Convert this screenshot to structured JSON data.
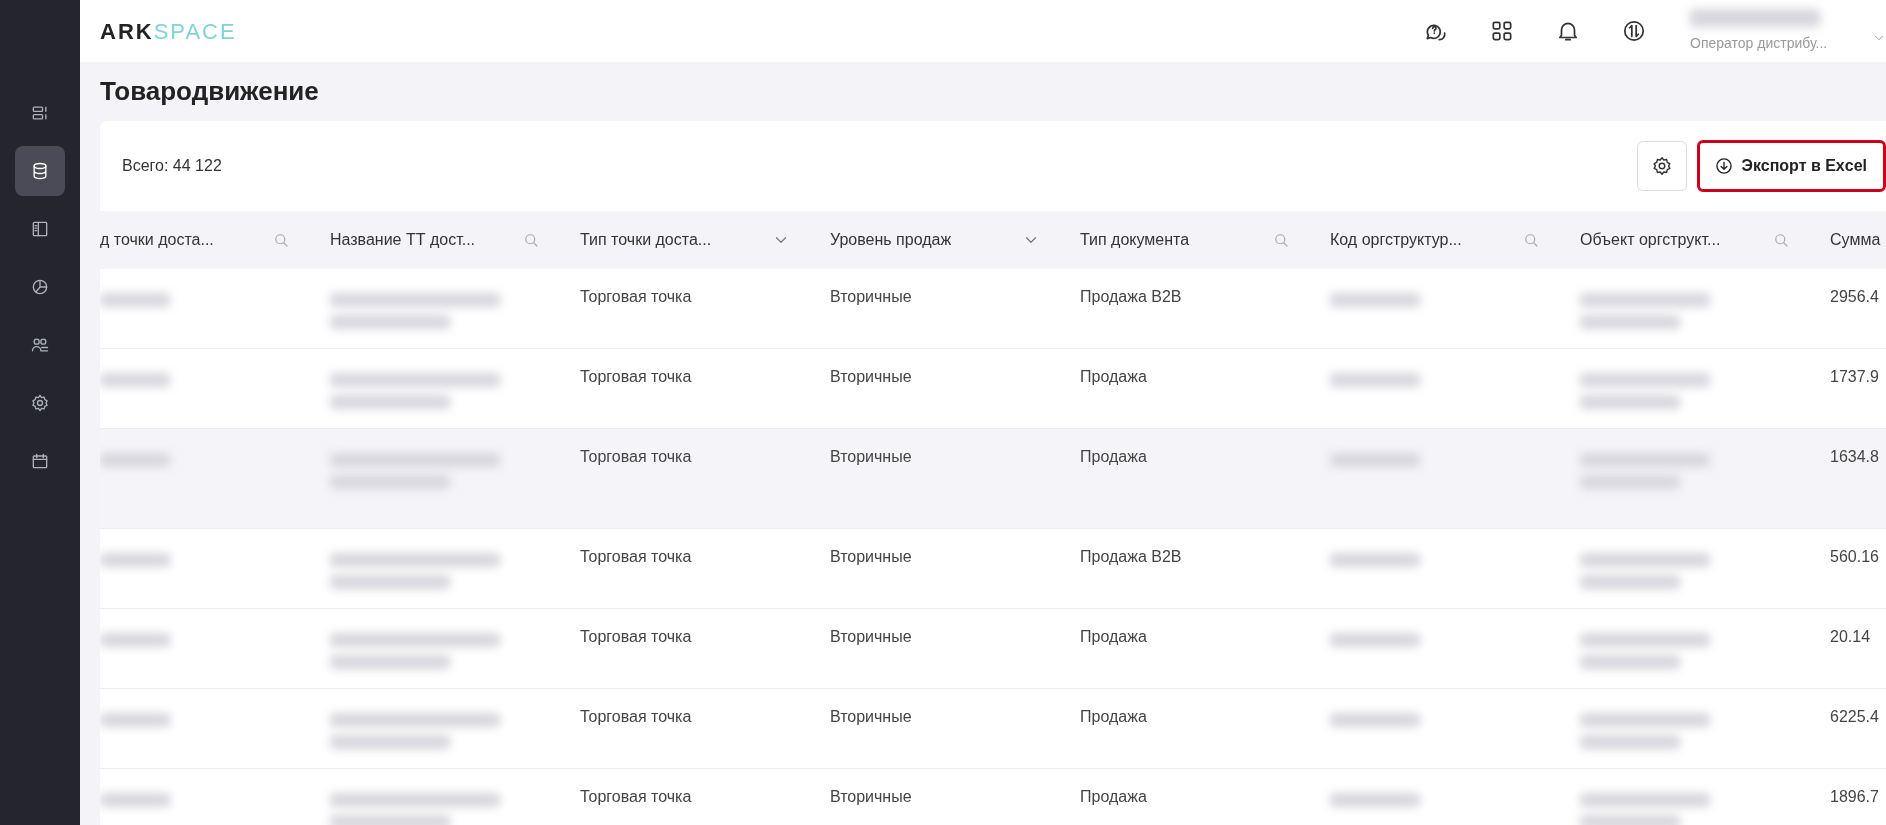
{
  "logo": {
    "part_1": "ARK",
    "part_2": "SPACE"
  },
  "user": {
    "role": "Оператор дистрибу..."
  },
  "sidebar": {
    "items": [
      {
        "selected": false
      },
      {
        "selected": true
      },
      {
        "selected": false
      },
      {
        "selected": false
      },
      {
        "selected": false
      },
      {
        "selected": false
      },
      {
        "selected": false
      }
    ]
  },
  "page_title": "Товародвижение",
  "total": "Всего: 44 122",
  "export_button": {
    "label": "Экспорт в Excel",
    "highlighted": true
  },
  "table": {
    "columns": [
      {
        "label": "д точки доста...",
        "kind": "search"
      },
      {
        "label": "Название ТТ дост...",
        "kind": "search"
      },
      {
        "label": "Тип точки доста...",
        "kind": "dropdown"
      },
      {
        "label": "Уровень продаж",
        "kind": "dropdown"
      },
      {
        "label": "Тип документа",
        "kind": "search"
      },
      {
        "label": "Код оргструктур...",
        "kind": "search"
      },
      {
        "label": "Объект оргструкт...",
        "kind": "search"
      },
      {
        "label": "Сумма",
        "kind": "plain"
      }
    ],
    "rows": [
      {
        "point_type": "Торговая точка",
        "sales_level": "Вторичные",
        "document_type": "Продажа B2B",
        "sum": "2956.4",
        "hovered": false
      },
      {
        "point_type": "Торговая точка",
        "sales_level": "Вторичные",
        "document_type": "Продажа",
        "sum": "1737.9",
        "hovered": false
      },
      {
        "point_type": "Торговая точка",
        "sales_level": "Вторичные",
        "document_type": "Продажа",
        "sum": "1634.8",
        "hovered": true
      },
      {
        "point_type": "Торговая точка",
        "sales_level": "Вторичные",
        "document_type": "Продажа B2B",
        "sum": "560.16",
        "hovered": false
      },
      {
        "point_type": "Торговая точка",
        "sales_level": "Вторичные",
        "document_type": "Продажа",
        "sum": "20.14",
        "hovered": false
      },
      {
        "point_type": "Торговая точка",
        "sales_level": "Вторичные",
        "document_type": "Продажа",
        "sum": "6225.4",
        "hovered": false
      },
      {
        "point_type": "Торговая точка",
        "sales_level": "Вторичные",
        "document_type": "Продажа",
        "sum": "1896.7",
        "hovered": false
      }
    ]
  }
}
